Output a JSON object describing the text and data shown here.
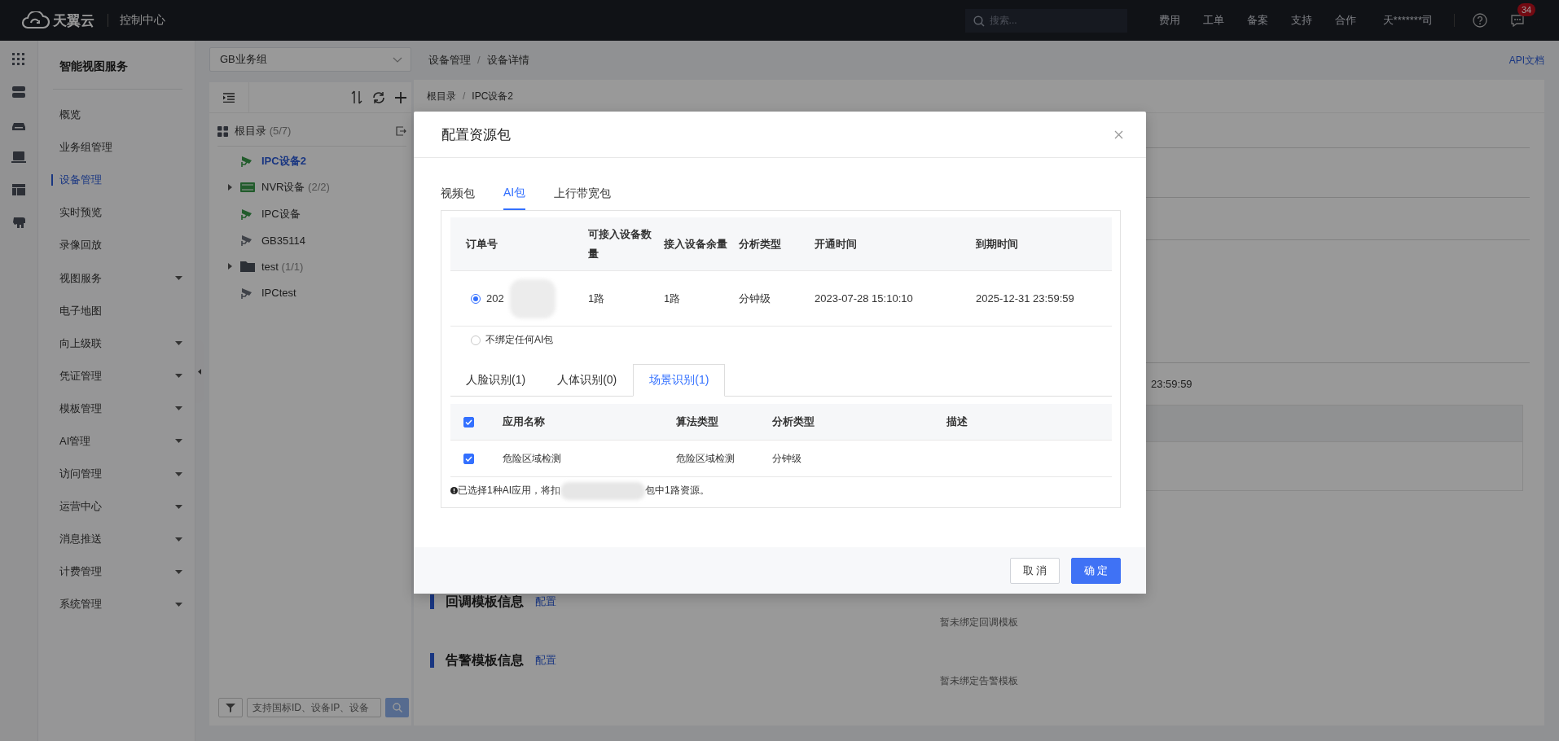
{
  "topbar": {
    "logo_text": "天翼云",
    "console": "控制中心",
    "search": {
      "placeholder": "搜索..."
    },
    "links": [
      "费用",
      "工单",
      "备案",
      "支持",
      "合作"
    ],
    "user": "天*******司",
    "message_badge": "34"
  },
  "nav": {
    "title": "智能视图服务",
    "items": [
      {
        "label": "概览",
        "selected": false,
        "has_submenu": false
      },
      {
        "label": "业务组管理",
        "selected": false,
        "has_submenu": false
      },
      {
        "label": "设备管理",
        "selected": true,
        "has_submenu": false
      },
      {
        "label": "实时预览",
        "selected": false,
        "has_submenu": false
      },
      {
        "label": "录像回放",
        "selected": false,
        "has_submenu": false
      },
      {
        "label": "视图服务",
        "selected": false,
        "has_submenu": true
      },
      {
        "label": "电子地图",
        "selected": false,
        "has_submenu": false
      },
      {
        "label": "向上级联",
        "selected": false,
        "has_submenu": true
      },
      {
        "label": "凭证管理",
        "selected": false,
        "has_submenu": true
      },
      {
        "label": "模板管理",
        "selected": false,
        "has_submenu": true
      },
      {
        "label": "AI管理",
        "selected": false,
        "has_submenu": true
      },
      {
        "label": "访问管理",
        "selected": false,
        "has_submenu": true
      },
      {
        "label": "运营中心",
        "selected": false,
        "has_submenu": true
      },
      {
        "label": "消息推送",
        "selected": false,
        "has_submenu": true
      },
      {
        "label": "计费管理",
        "selected": false,
        "has_submenu": true
      },
      {
        "label": "系统管理",
        "selected": false,
        "has_submenu": true
      }
    ]
  },
  "tree": {
    "group_select": "GB业务组",
    "root": {
      "label": "根目录",
      "count": "(5/7)"
    },
    "nodes": [
      {
        "kind": "camera",
        "label": "IPC设备2",
        "online": true,
        "selected": true,
        "has_children": false
      },
      {
        "kind": "nvr",
        "label": "NVR设备",
        "count": "(2/2)",
        "online": true,
        "selected": false,
        "has_children": true
      },
      {
        "kind": "camera",
        "label": "IPC设备",
        "online": true,
        "selected": false,
        "has_children": false
      },
      {
        "kind": "camera",
        "label": "GB35114",
        "online": false,
        "selected": false,
        "has_children": false
      },
      {
        "kind": "folder",
        "label": "test",
        "count": "(1/1)",
        "online": false,
        "selected": false,
        "has_children": true
      },
      {
        "kind": "camera",
        "label": "IPCtest",
        "online": false,
        "selected": false,
        "has_children": false
      }
    ],
    "search": {
      "placeholder": "支持国标ID、设备IP、设备"
    }
  },
  "main": {
    "breadcrumb": [
      "设备管理",
      "设备详情"
    ],
    "breadcrumb_separator": "/",
    "sub_breadcrumb_separator": "/",
    "api_link": "API文档",
    "sub_breadcrumb": [
      "根目录",
      "IPC设备2"
    ],
    "peek_time": "23:59:59",
    "sections": [
      {
        "title": "回调模板信息",
        "action": "配置",
        "empty": "暂未绑定回调模板"
      },
      {
        "title": "告警模板信息",
        "action": "配置",
        "empty": "暂未绑定告警模板"
      }
    ]
  },
  "modal": {
    "title": "配置资源包",
    "tabs": [
      {
        "label": "视频包",
        "selected": false
      },
      {
        "label": "AI包",
        "selected": true
      },
      {
        "label": "上行带宽包",
        "selected": false
      }
    ],
    "columns": [
      "订单号",
      "可接入设备数量",
      "接入设备余量",
      "分析类型",
      "开通时间",
      "到期时间"
    ],
    "rows": [
      {
        "selected": true,
        "cells": [
          "202",
          "1路",
          "1路",
          "分钟级",
          "2023-07-28 15:10:10",
          "2025-12-31 23:59:59"
        ]
      }
    ],
    "none_option": {
      "label": "不绑定任何AI包",
      "selected": false
    },
    "subtabs": [
      {
        "label": "人脸识别(1)",
        "selected": false
      },
      {
        "label": "人体识别(0)",
        "selected": false
      },
      {
        "label": "场景识别(1)",
        "selected": true
      }
    ],
    "app_columns": [
      "应用名称",
      "算法类型",
      "分析类型",
      "描述"
    ],
    "all_checked": true,
    "app_rows": [
      {
        "checked": true,
        "cells": [
          "危险区域检测",
          "危险区域检测",
          "分钟级"
        ]
      }
    ],
    "note_before": "已选择1种AI应用，将扣",
    "note_after": "包中1路资源。",
    "buttons": [
      {
        "label": "取 消",
        "kind": "secondary"
      },
      {
        "label": "确 定",
        "kind": "primary"
      }
    ]
  }
}
